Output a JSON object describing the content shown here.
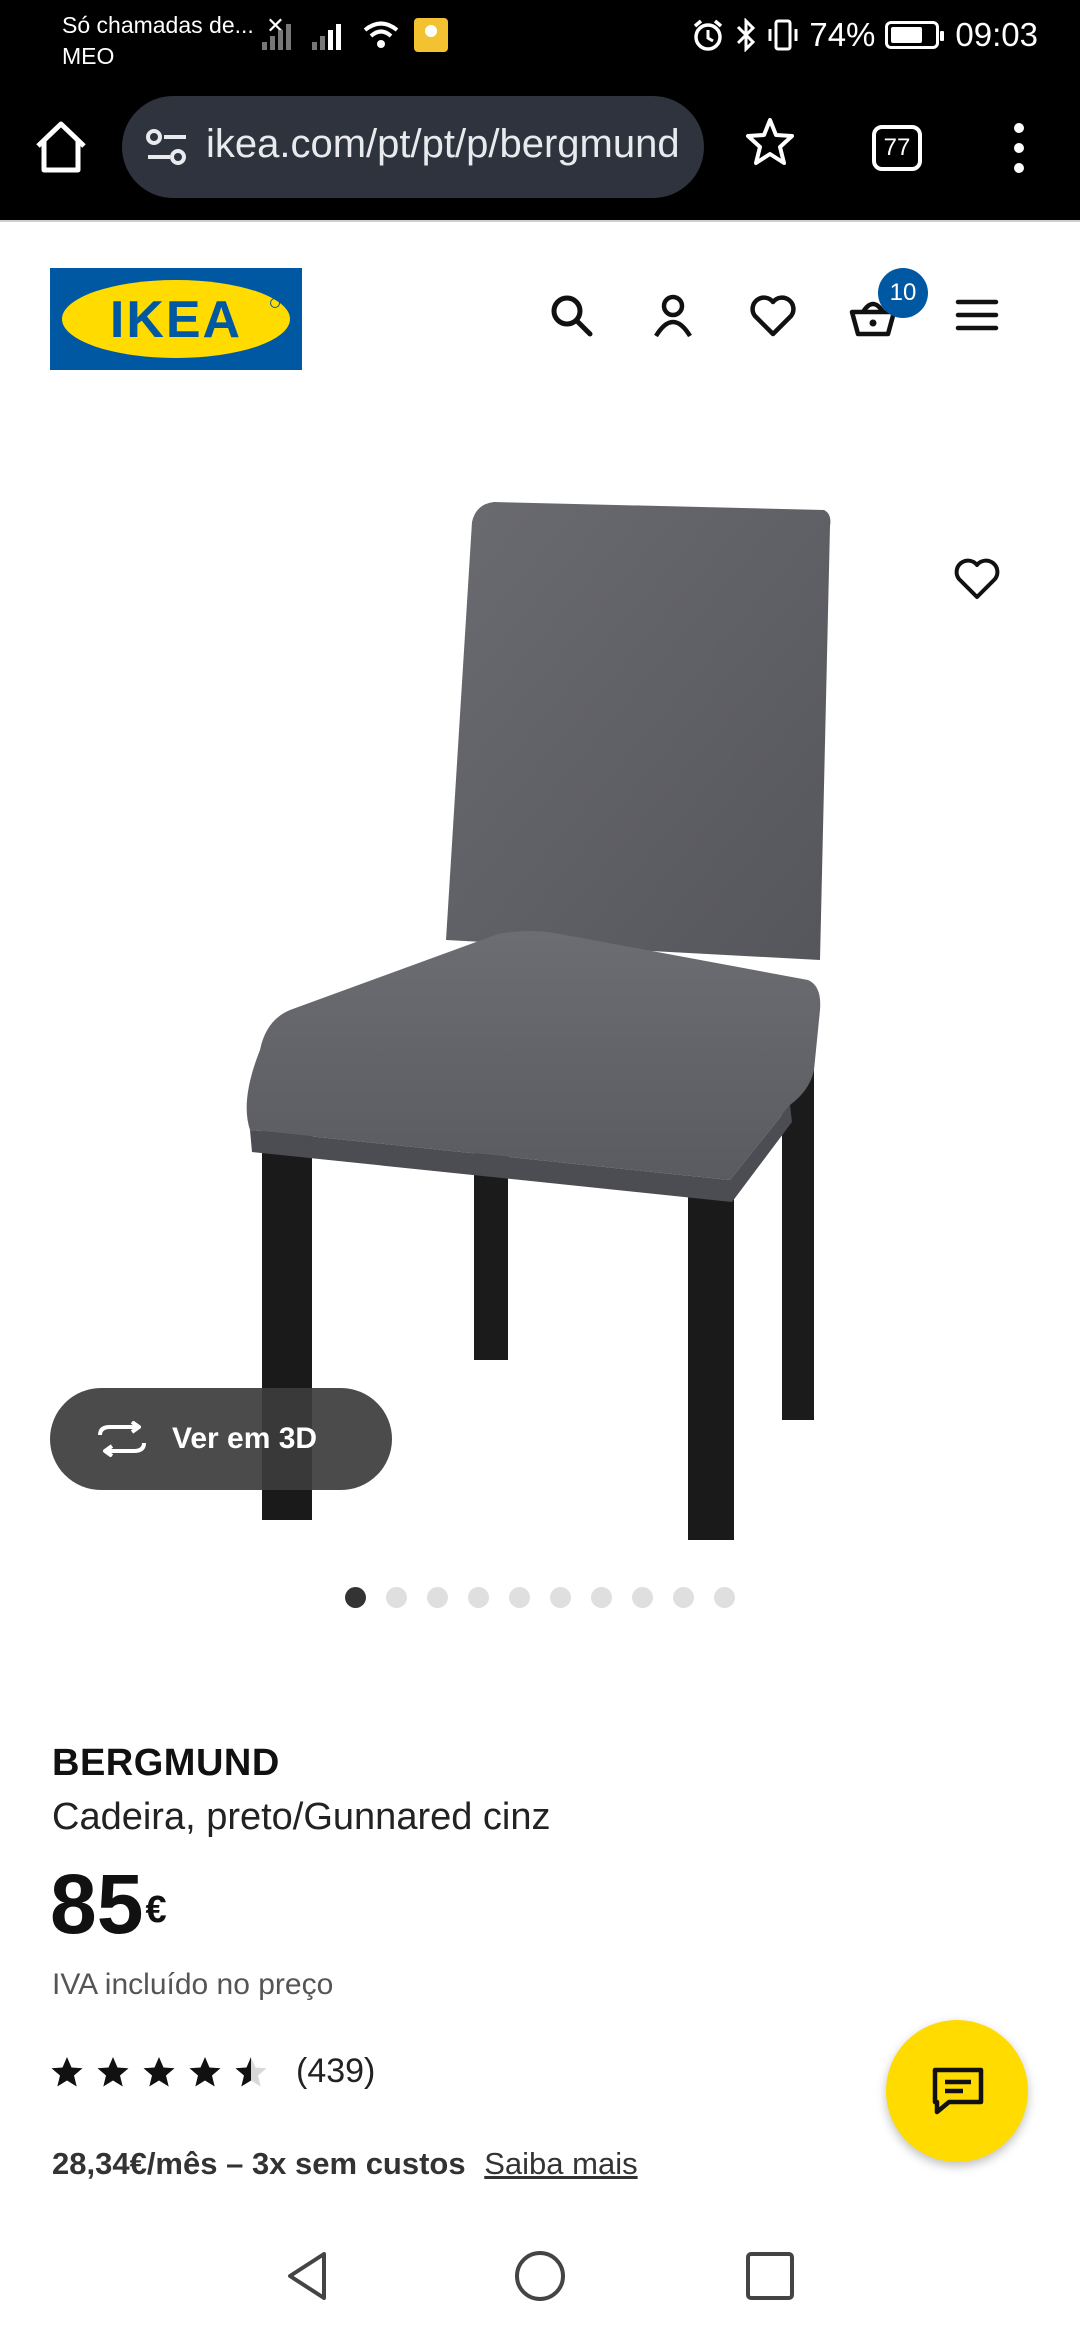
{
  "status_bar": {
    "carrier_line1": "Só chamadas de...",
    "carrier_line2": "MEO",
    "battery_text": "74%",
    "battery_level": 0.74,
    "time": "09:03"
  },
  "browser": {
    "url": "ikea.com/pt/pt/p/bergmund",
    "tab_count": "77"
  },
  "header": {
    "logo_text": "IKEA",
    "cart_count": "10"
  },
  "gallery": {
    "view_3d_label": "Ver em 3D",
    "image_count": 10,
    "active_index": 0
  },
  "product": {
    "name": "BERGMUND",
    "description": "Cadeira, preto/Gunnared cinz",
    "price": "85",
    "currency": "€",
    "vat_note": "IVA incluído no preço",
    "rating": 4.5,
    "review_count": "(439)",
    "installments": "28,34€/mês – 3x sem custos",
    "learn_more": "Saiba mais"
  },
  "colors": {
    "ikea_blue": "#0058a3",
    "ikea_yellow": "#ffdb00"
  }
}
